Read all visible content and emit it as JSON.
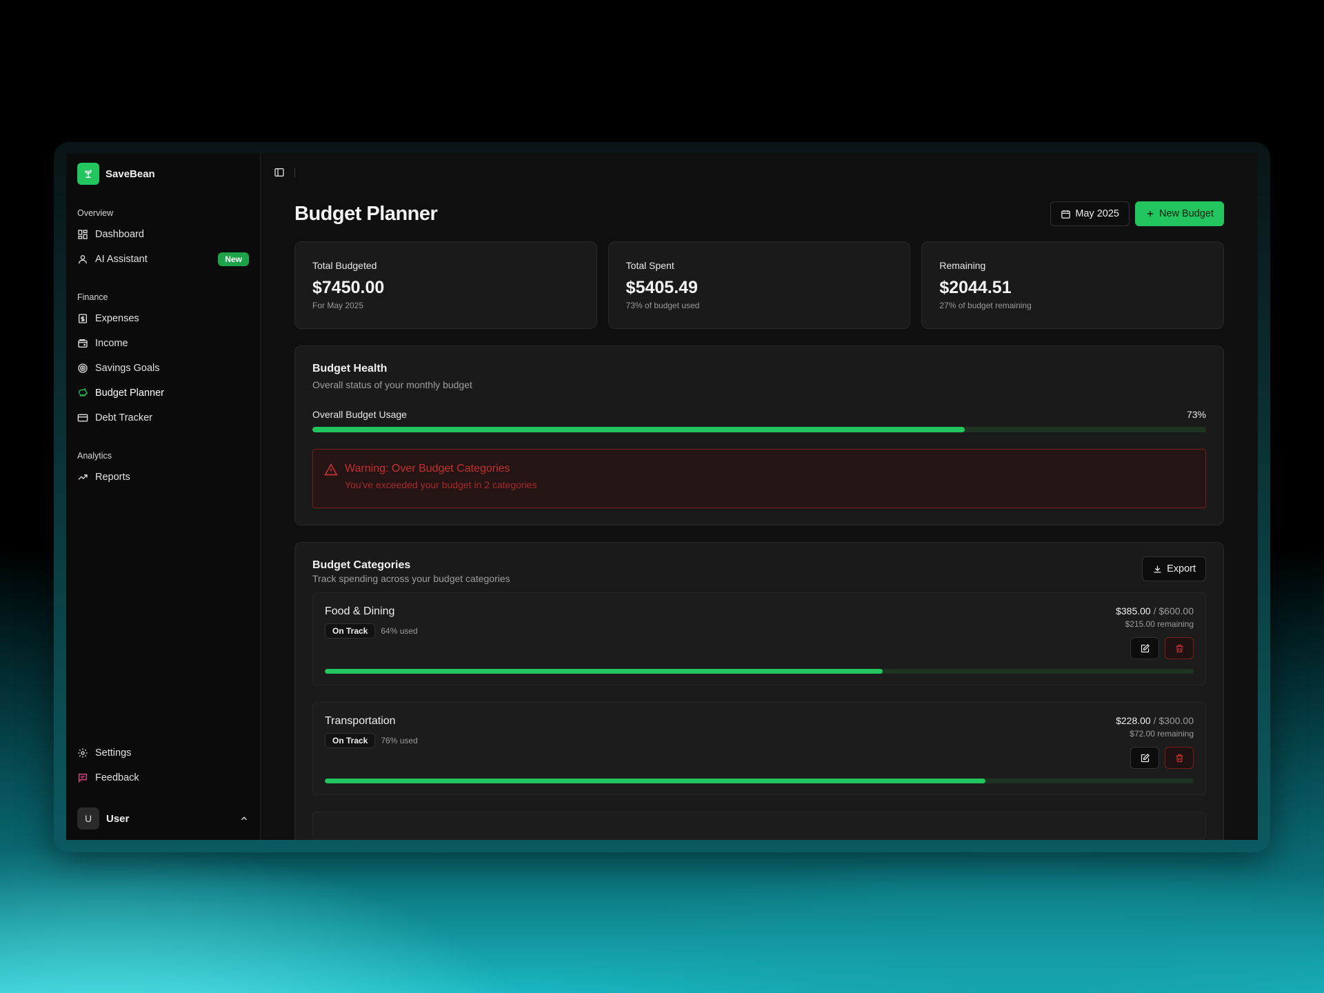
{
  "brand": {
    "name": "SaveBean"
  },
  "sidebar": {
    "sections": [
      {
        "label": "Overview",
        "items": [
          {
            "label": "Dashboard",
            "icon": "dashboard-icon"
          },
          {
            "label": "AI Assistant",
            "icon": "user-icon",
            "badge": "New"
          }
        ]
      },
      {
        "label": "Finance",
        "items": [
          {
            "label": "Expenses",
            "icon": "receipt-icon"
          },
          {
            "label": "Income",
            "icon": "wallet-icon"
          },
          {
            "label": "Savings Goals",
            "icon": "target-icon"
          },
          {
            "label": "Budget Planner",
            "icon": "piggy-bank-icon",
            "active": true
          },
          {
            "label": "Debt Tracker",
            "icon": "credit-card-icon"
          }
        ]
      },
      {
        "label": "Analytics",
        "items": [
          {
            "label": "Reports",
            "icon": "trending-up-icon"
          }
        ]
      }
    ],
    "bottom": [
      {
        "label": "Settings",
        "icon": "gear-icon"
      },
      {
        "label": "Feedback",
        "icon": "message-icon"
      }
    ],
    "user": {
      "initial": "U",
      "name": "User"
    }
  },
  "header": {
    "title": "Budget Planner",
    "month_label": "May 2025",
    "new_budget_label": "New Budget"
  },
  "stats": [
    {
      "label": "Total Budgeted",
      "value": "$7450.00",
      "sub": "For May 2025"
    },
    {
      "label": "Total Spent",
      "value": "$5405.49",
      "sub": "73% of budget used"
    },
    {
      "label": "Remaining",
      "value": "$2044.51",
      "sub": "27% of budget remaining"
    }
  ],
  "health": {
    "title": "Budget Health",
    "subtitle": "Overall status of your monthly budget",
    "usage_label": "Overall Budget Usage",
    "usage_percent_label": "73%",
    "usage_fraction": 0.73,
    "warning_title": "Warning: Over Budget Categories",
    "warning_sub": "You've exceeded your budget in 2 categories"
  },
  "categories": {
    "title": "Budget Categories",
    "subtitle": "Track spending across your budget categories",
    "export_label": "Export",
    "items": [
      {
        "name": "Food & Dining",
        "status": "On Track",
        "used": "64% used",
        "spent": "$385.00",
        "total": "$600.00",
        "remaining": "$215.00 remaining",
        "fraction": 0.642
      },
      {
        "name": "Transportation",
        "status": "On Track",
        "used": "76% used",
        "spent": "$228.00",
        "total": "$300.00",
        "remaining": "$72.00 remaining",
        "fraction": 0.76
      }
    ]
  },
  "colors": {
    "accent": "#22c55e",
    "danger": "#c43131",
    "feedback": "#e0468a"
  }
}
